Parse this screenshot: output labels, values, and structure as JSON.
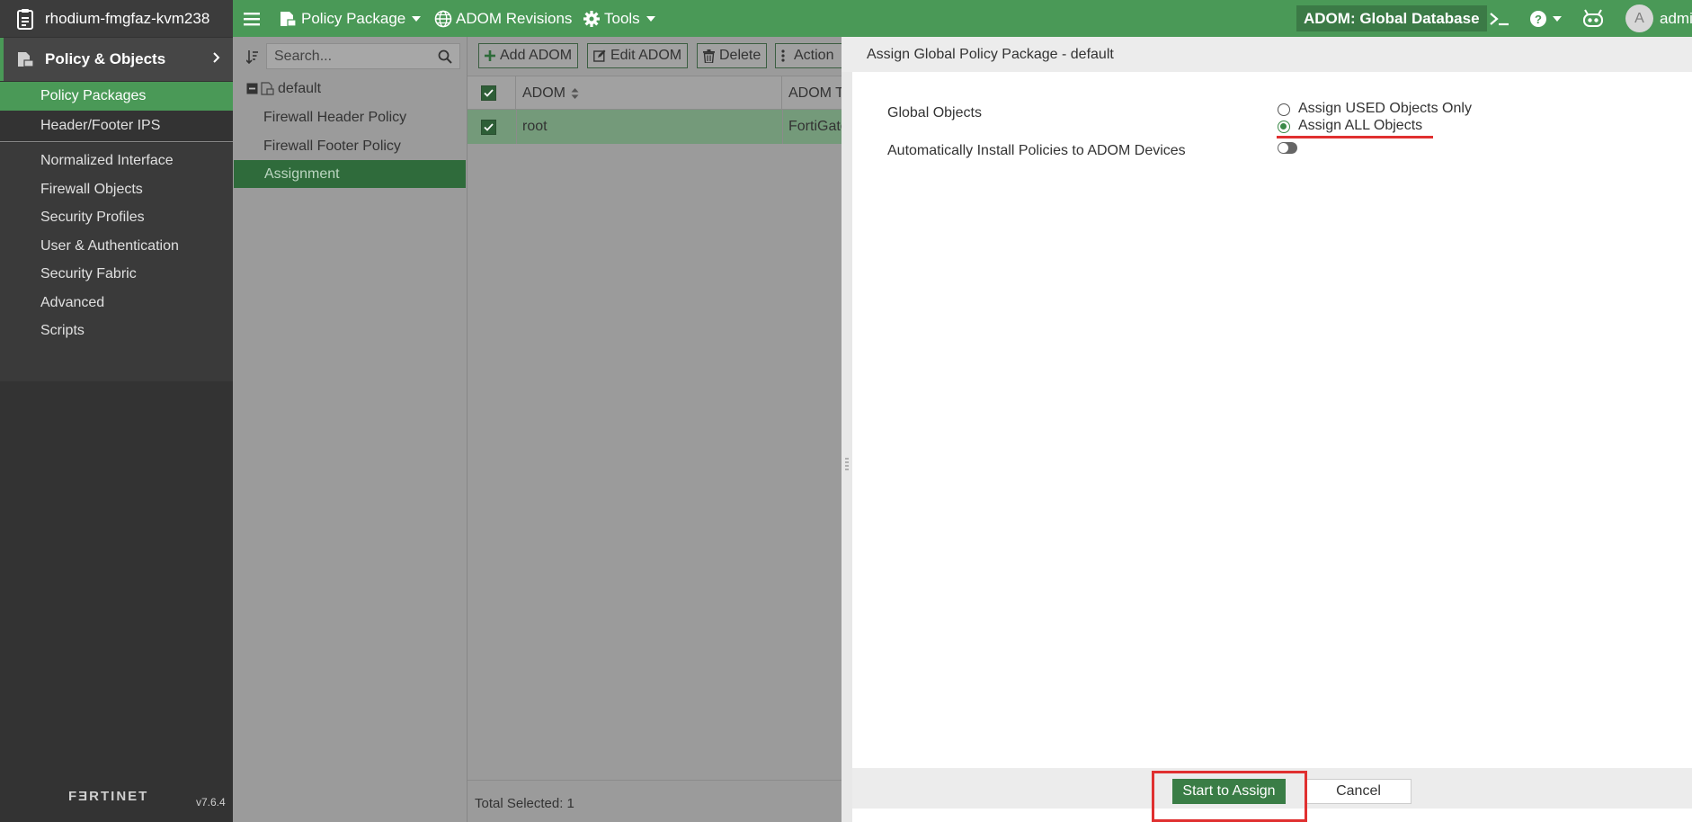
{
  "topbar": {
    "hostname": "rhodium-fmgfaz-kvm238",
    "menu_policy_package": "Policy Package",
    "menu_adom_revisions": "ADOM Revisions",
    "menu_tools": "Tools",
    "adom_badge": "ADOM: Global Database",
    "avatar_letter": "A",
    "user": "admin",
    "icons": [
      "clipboard-icon",
      "hamburger-icon",
      "policy-package-icon",
      "globe-icon",
      "gear-icon",
      "terminal-icon",
      "help-icon",
      "fortinet-bot-icon"
    ]
  },
  "leftnav": {
    "header": "Policy & Objects",
    "items": [
      {
        "label": "Policy Packages",
        "active": true
      },
      {
        "label": "Header/Footer IPS"
      },
      {
        "label": "Normalized Interface"
      },
      {
        "label": "Firewall Objects"
      },
      {
        "label": "Security Profiles"
      },
      {
        "label": "User & Authentication"
      },
      {
        "label": "Security Fabric"
      },
      {
        "label": "Advanced"
      },
      {
        "label": "Scripts"
      }
    ],
    "brand": "FƎRTINET",
    "version": "v7.6.4"
  },
  "tree": {
    "search_placeholder": "Search...",
    "root": "default",
    "items": [
      "Firewall Header Policy",
      "Firewall Footer Policy",
      "Assignment"
    ],
    "selected": "Assignment"
  },
  "list": {
    "buttons": {
      "add": "Add ADOM",
      "edit": "Edit ADOM",
      "delete": "Delete",
      "action": "Action"
    },
    "columns": {
      "adom": "ADOM",
      "adom_type": "ADOM T"
    },
    "rows": [
      {
        "adom": "root",
        "type": "FortiGate",
        "checked": true
      }
    ],
    "footer": "Total Selected: 1"
  },
  "dialog": {
    "title": "Assign Global Policy Package - default",
    "global_objects_label": "Global Objects",
    "option_used": "Assign USED Objects Only",
    "option_all": "Assign ALL Objects",
    "selected_option": "Assign ALL Objects",
    "auto_install_label": "Automatically Install Policies to ADOM Devices",
    "auto_install": false,
    "primary_button": "Start to Assign",
    "cancel_button": "Cancel"
  },
  "colors": {
    "brand_green": "#4a9957",
    "dark_nav": "#333333",
    "annotation_red": "#e03030"
  }
}
